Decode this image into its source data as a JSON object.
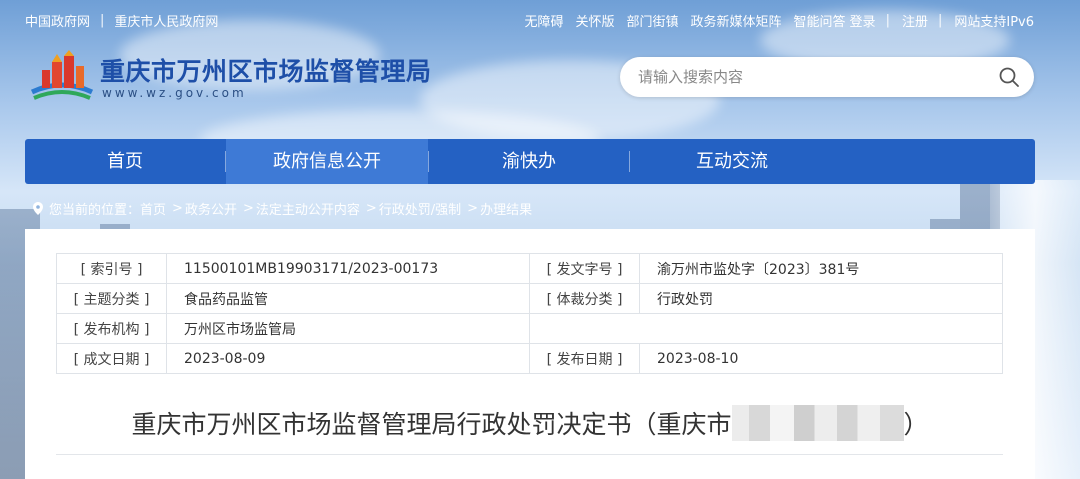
{
  "topbar": {
    "left_links": [
      "中国政府网",
      "重庆市人民政府网"
    ],
    "right_links": [
      "无障碍",
      "关怀版",
      "部门街镇",
      "政务新媒体矩阵",
      "智能问答"
    ],
    "login": "登录",
    "register": "注册",
    "ipv6": "网站支持IPv6",
    "separator": "|"
  },
  "header": {
    "title": "重庆市万州区市场监督管理局",
    "domain": "www.wz.gov.com",
    "search_placeholder": "请输入搜索内容"
  },
  "nav": {
    "items": [
      "首页",
      "政府信息公开",
      "渝快办",
      "互动交流"
    ],
    "active_index": 1
  },
  "breadcrumb": {
    "prefix": "您当前的位置：",
    "items": [
      "首页",
      "政务公开",
      "法定主动公开内容",
      "行政处罚/强制",
      "办理结果"
    ],
    "arrow": ">"
  },
  "meta": {
    "index_label": "[ 索引号 ]",
    "index_value": "11500101MB19903171/2023-00173",
    "docno_label": "[ 发文字号 ]",
    "docno_value": "渝万州市监处字〔2023〕381号",
    "topic_label": "[ 主题分类 ]",
    "topic_value": "食品药品监管",
    "genre_label": "[ 体裁分类 ]",
    "genre_value": "行政处罚",
    "issuer_label": "[ 发布机构 ]",
    "issuer_value": "万州区市场监管局",
    "created_label": "[ 成文日期 ]",
    "created_value": "2023-08-09",
    "published_label": "[ 发布日期 ]",
    "published_value": "2023-08-10"
  },
  "document": {
    "title_visible": "重庆市万州区市场监督管理局行政处罚决定书（重庆市",
    "title_close": "）"
  },
  "colors": {
    "nav_bg": "#2461c3",
    "nav_active": "#3e7ad6",
    "title_blue": "#1e4fa8"
  }
}
